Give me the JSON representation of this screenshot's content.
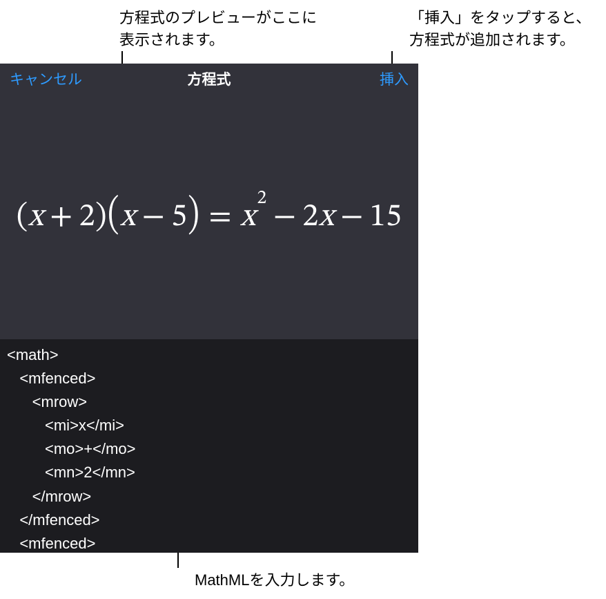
{
  "callouts": {
    "preview": "方程式のプレビューがここに\n表示されます。",
    "insert": "「挿入」をタップすると、\n方程式が追加されます。",
    "mathml": "MathMLを入力します。"
  },
  "nav": {
    "cancel": "キャンセル",
    "title": "方程式",
    "insert": "挿入"
  },
  "equation": {
    "parts": {
      "lpar": "(",
      "rpar": ")",
      "x": "x",
      "plus": "+",
      "minus": "−",
      "eq": "=",
      "n2": "2",
      "n5": "5",
      "n15": "15",
      "sup2": "2"
    }
  },
  "code_text": "<math>\n   <mfenced>\n      <mrow>\n         <mi>x</mi>\n         <mo>+</mo>\n         <mn>2</mn>\n      </mrow>\n   </mfenced>\n   <mfenced>\n      <mrow>"
}
